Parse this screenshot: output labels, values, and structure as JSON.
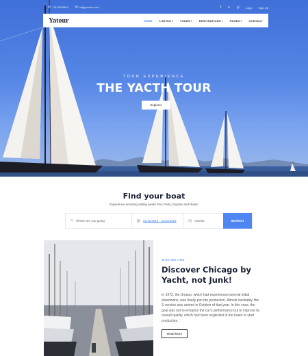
{
  "topbar": {
    "phone": "+31 4020594",
    "email": "hi@yourdo.com",
    "social_icons": [
      "facebook-icon",
      "twitter-icon",
      "instagram-icon"
    ],
    "login": "Login",
    "signup": "Sign Up"
  },
  "nav": {
    "logo": "Yatour",
    "items": [
      {
        "label": "HOME",
        "active": true
      },
      {
        "label": "LISTING",
        "dropdown": true
      },
      {
        "label": "TOURS",
        "dropdown": true
      },
      {
        "label": "DESTINATIONS",
        "dropdown": true
      },
      {
        "label": "PAGES",
        "dropdown": true
      },
      {
        "label": "CONTACT"
      }
    ]
  },
  "hero": {
    "subtitle": "TOUR EXPERIENCE",
    "title": "THE YACTH TOUR",
    "button": "Explorer"
  },
  "find": {
    "title": "Find your boat",
    "subtitle": "Experience amazing sailing week! Sail, Party, Explore and Relax!",
    "where_placeholder": "Where are you going",
    "date_value": "01/11/2019 - 01/11/2019",
    "guests_placeholder": "Guests",
    "search_button": "SEARCH"
  },
  "about": {
    "eyebrow": "WHO WE ARE",
    "title": "Discover Chicago by Yacht, not Junk!",
    "text": "In 1972, the Umaoo, which had experienced several initial slowdowns, was finally put into production. Almost inevitably, the S version also arrived in October of that year. In this case, the goal was not to enhance the car's performance but to improve its overall quality, which had been neglected in the haste to start production.",
    "button": "Read More"
  },
  "colors": {
    "accent": "#4f86f2",
    "link": "#3b82f6",
    "hero_sky": "#4f7ee0",
    "dark_text": "#1c2236"
  }
}
